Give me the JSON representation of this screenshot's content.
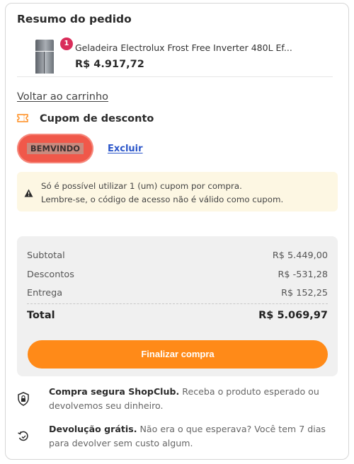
{
  "summary_title": "Resumo do pedido",
  "product": {
    "quantity": "1",
    "name": "Geladeira Electrolux Frost Free Inverter 480L Ef...",
    "price": "R$ 4.917,72"
  },
  "back_link": "Voltar ao carrinho",
  "coupon": {
    "title": "Cupom de desconto",
    "code": "BEMVINDO",
    "remove_label": "Excluir",
    "notice_line1": "Só é possível utilizar 1 (um) cupom por compra.",
    "notice_line2": "Lembre-se, o código de acesso não é válido como cupom."
  },
  "totals": {
    "subtotal_label": "Subtotal",
    "subtotal_value": "R$ 5.449,00",
    "discount_label": "Descontos",
    "discount_value": "R$ -531,28",
    "shipping_label": "Entrega",
    "shipping_value": "R$ 152,25",
    "total_label": "Total",
    "total_value": "R$ 5.069,97"
  },
  "checkout_label": "Finalizar compra",
  "features": {
    "secure_title": "Compra segura ShopClub.",
    "secure_text": "Receba o produto esperado ou devolvemos seu dinheiro.",
    "return_title": "Devolução grátis.",
    "return_text": "Não era o que esperava? Você tem 7 dias para devolver sem custo algum."
  },
  "colors": {
    "accent_orange": "#ff8a18",
    "badge_pink": "#d92d5a",
    "coupon_red": "#f0584a",
    "link_blue": "#2a55c9",
    "notice_bg": "#fdf7e3"
  }
}
